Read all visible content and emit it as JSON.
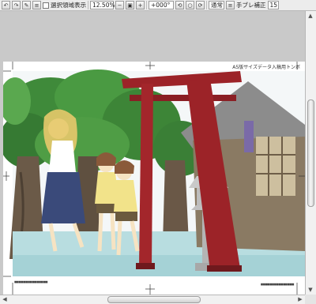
{
  "toolbar": {
    "selection_display_label": "選択領域表示",
    "zoom_value": "12.50%",
    "rotation_value": "+000°",
    "blend_mode": "通常",
    "stabilizer_label": "手ブレ補正",
    "stabilizer_value": "15"
  },
  "canvas": {
    "doc_title": "A5版サイズデータ入稿用トンボ",
    "bottom_note_left": "■■■■■■■■■■■■■■■",
    "bottom_note_right": "■■■■■■■■■■■■■■■"
  },
  "colors": {
    "toolbar_bg": "#ececec",
    "workspace_bg": "#c9c9c9",
    "torii_red": "#9c2328",
    "foliage": "#3f8a3a"
  }
}
